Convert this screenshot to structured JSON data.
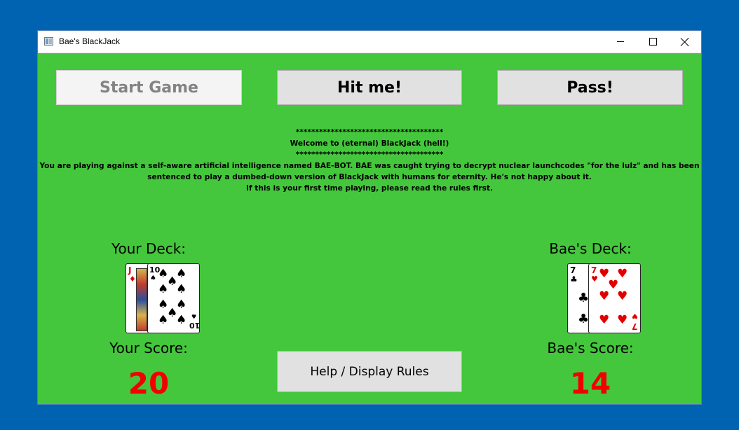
{
  "window": {
    "title": "Bae's BlackJack"
  },
  "buttons": {
    "start": "Start Game",
    "hit": "Hit me!",
    "pass": "Pass!",
    "help": "Help / Display Rules"
  },
  "message": {
    "stars": "**************************************",
    "welcome": "Welcome to (eternal) BlackJack (hell!)",
    "line1": "You are playing against a self-aware artificial intelligence named BAE-BOT. BAE was caught trying to decrypt nuclear launchcodes \"for the lulz\" and has been",
    "line2": "sentenced to play a dumbed-down version of BlackJack with humans for eternity. He's not happy about it.",
    "line3": "If this is your first time playing, please read the rules first."
  },
  "player": {
    "deck_label": "Your Deck:",
    "score_label": "Your Score:",
    "score": "20",
    "cards": [
      {
        "rank": "J",
        "suit": "diamonds"
      },
      {
        "rank": "10",
        "suit": "spades"
      }
    ]
  },
  "bae": {
    "deck_label": "Bae's Deck:",
    "score_label": "Bae's Score:",
    "score": "14",
    "cards": [
      {
        "rank": "7",
        "suit": "clubs"
      },
      {
        "rank": "7",
        "suit": "hearts"
      }
    ]
  },
  "colors": {
    "desktop": "#0063B1",
    "table_green": "#44C73C",
    "score_red": "#F20000",
    "button_face": "#E1E1E1"
  },
  "icons": [
    "app-icon",
    "minimize-icon",
    "maximize-icon",
    "close-icon"
  ]
}
